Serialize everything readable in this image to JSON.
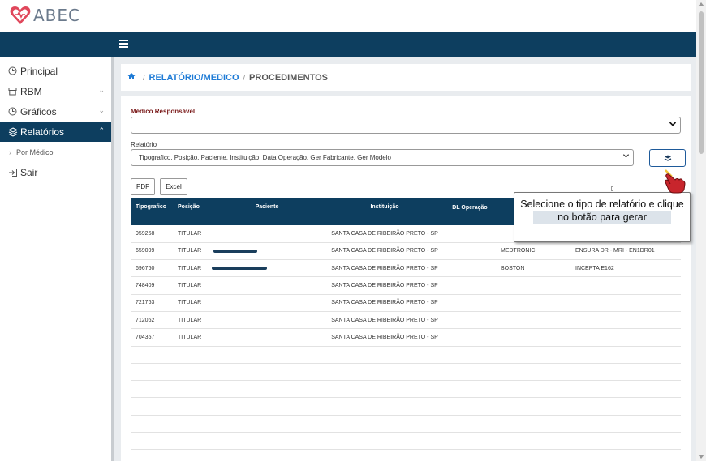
{
  "app": {
    "logo_text": "ABEC"
  },
  "sidebar": {
    "items": [
      {
        "label": "Principal",
        "icon": "clock-icon"
      },
      {
        "label": "RBM",
        "icon": "archive-icon"
      },
      {
        "label": "Gráficos",
        "icon": "clock-icon"
      },
      {
        "label": "Relatórios",
        "icon": "layers-icon"
      },
      {
        "label": "Sair",
        "icon": "logout-icon"
      }
    ],
    "sub_item": "Por Médico"
  },
  "breadcrumb": {
    "link": "RELATÓRIO/MEDICO",
    "current": "PROCEDIMENTOS"
  },
  "form": {
    "medico_label": "Médico Responsável",
    "medico_value": "",
    "relatorio_label": "Relatório",
    "relatorio_value": "Tipografico, Posição, Paciente, Instituição, Data Operação, Ger Fabricante, Ger Modelo"
  },
  "buttons": {
    "pdf": "PDF",
    "excel": "Excel"
  },
  "table": {
    "headers": [
      "Tipografico",
      "Posição",
      "Paciente",
      "Instituição",
      "DL Operação",
      "",
      ""
    ],
    "rows": [
      [
        "959268",
        "TITULAR",
        "",
        "SANTA CASA DE RIBEIRÃO PRETO - SP",
        "",
        "",
        ""
      ],
      [
        "659099",
        "TITULAR",
        "",
        "SANTA CASA DE RIBEIRÃO PRETO - SP",
        "",
        "MEDTRONIC",
        "ENSURA DR - MRI - EN1DR01"
      ],
      [
        "696760",
        "TITULAR",
        "",
        "SANTA CASA DE RIBEIRÃO PRETO - SP",
        "",
        "BOSTON",
        "INCEPTA E162"
      ],
      [
        "748409",
        "TITULAR",
        "",
        "SANTA CASA DE RIBEIRÃO PRETO - SP",
        "",
        "",
        ""
      ],
      [
        "721763",
        "TITULAR",
        "",
        "SANTA CASA DE RIBEIRÃO PRETO - SP",
        "",
        "",
        ""
      ],
      [
        "712062",
        "TITULAR",
        "",
        "SANTA CASA DE RIBEIRÃO PRETO - SP",
        "",
        "",
        ""
      ],
      [
        "704357",
        "TITULAR",
        "",
        "SANTA CASA DE RIBEIRÃO PRETO - SP",
        "",
        "",
        ""
      ],
      [
        "",
        "",
        "",
        "",
        "",
        "",
        ""
      ],
      [
        "",
        "",
        "",
        "",
        "",
        "",
        ""
      ],
      [
        "",
        "",
        "",
        "",
        "",
        "",
        ""
      ],
      [
        "",
        "",
        "",
        "",
        "",
        "",
        ""
      ],
      [
        "",
        "",
        "",
        "",
        "",
        "",
        ""
      ],
      [
        "",
        "",
        "",
        "",
        "",
        "",
        ""
      ]
    ]
  },
  "tooltip": {
    "line1": "Selecione o tipo de relatório e clique",
    "line2": "no botão para gerar"
  },
  "colors": {
    "navbar": "#0d3e5f",
    "link": "#1e7bd6",
    "logo": "#e0475b"
  }
}
